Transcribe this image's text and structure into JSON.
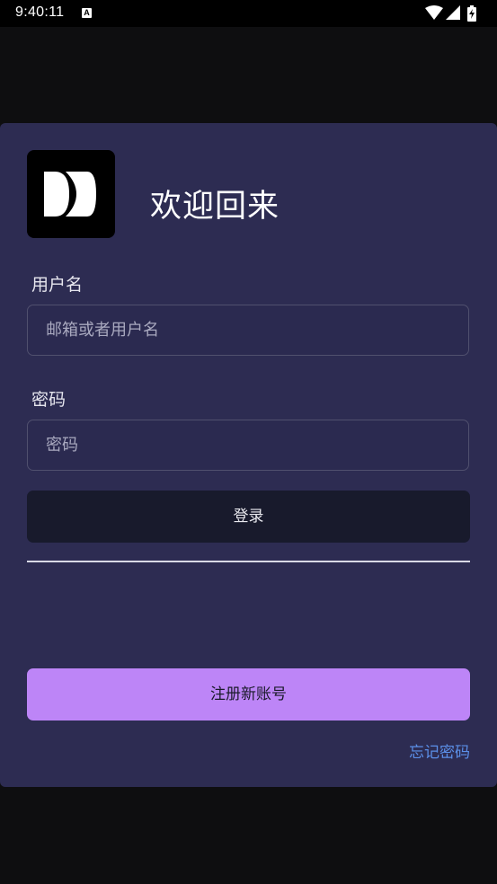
{
  "status_bar": {
    "time": "9:40:11",
    "notification_badge": "A",
    "icons": [
      "wifi-icon",
      "signal-icon",
      "battery-icon"
    ]
  },
  "login": {
    "title": "欢迎回来",
    "username_label": "用户名",
    "username_placeholder": "邮箱或者用户名",
    "username_value": "",
    "password_label": "密码",
    "password_placeholder": "密码",
    "password_value": "",
    "login_button": "登录",
    "register_button": "注册新账号",
    "forgot_password": "忘记密码"
  },
  "colors": {
    "background": "#0e0e10",
    "card": "#2d2c52",
    "login_button": "#181a2c",
    "register_button": "#bd85f7",
    "link": "#5b8fe8"
  }
}
